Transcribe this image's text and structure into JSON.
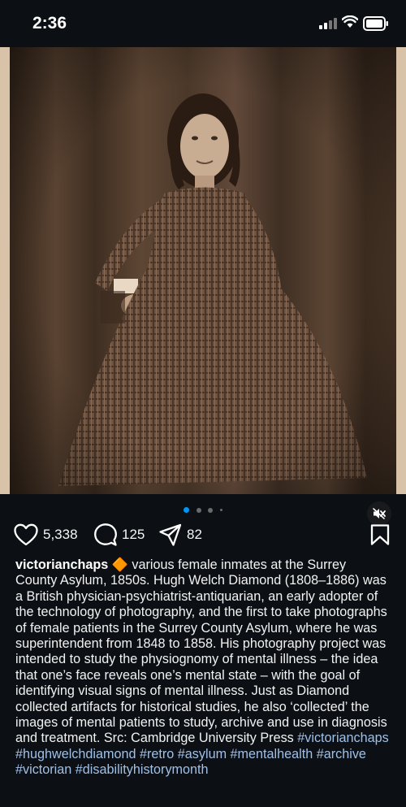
{
  "status_bar": {
    "time": "2:36"
  },
  "post": {
    "carousel": {
      "dot_count": 4,
      "active_index": 0
    },
    "likes": "5,338",
    "comments": "125",
    "shares": "82",
    "username": "victorianchaps",
    "badge": "🔶",
    "caption": "various female inmates at the Surrey County Asylum, 1850s. Hugh Welch Diamond (1808–1886) was a British physician-psychiatrist-antiquarian, an early adopter of the technology of photography, and the first to take photographs of female patients in the Surrey County Asylum, where he was superintendent from 1848 to 1858. His photography project was intended to study the physiognomy of mental illness – the idea that one’s face reveals one’s mental state – with the goal of identifying visual signs of mental illness. Just as Diamond collected artifacts for historical studies, he also ‘collected’ the images of mental patients to study, archive and use in diagnosis and treatment. Src: Cambridge University Press",
    "hashtags": "#victorianchaps #hughwelchdiamond #retro #asylum #mentalhealth #archive #victorian #disabilityhistorymonth"
  },
  "colors": {
    "background": "#0c1014",
    "accent": "#0095f6",
    "hashtag": "#9fc0e8"
  }
}
